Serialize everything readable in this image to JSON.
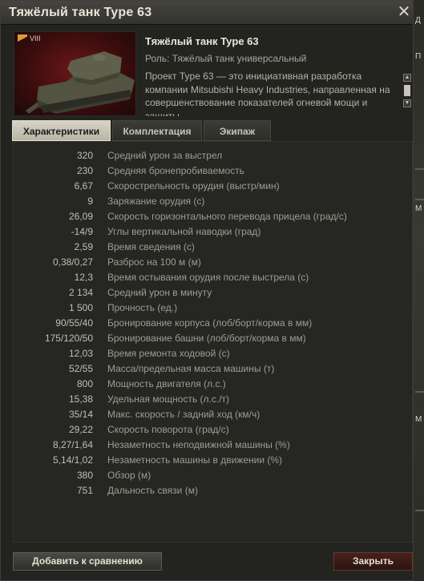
{
  "window": {
    "title": "Тяжёлый танк Type 63",
    "close_glyph": "✕"
  },
  "tank": {
    "tier": "VIII",
    "name": "Тяжёлый танк Type 63",
    "role": "Роль: Тяжёлый танк универсальный",
    "description": "Проект Type 63 — это инициативная разработка компании Mitsubishi Heavy Industries, направленная на совершенствование показателей огневой мощи и защиты"
  },
  "tabs": [
    {
      "label": "Характеристики",
      "active": true
    },
    {
      "label": "Комплектация",
      "active": false
    },
    {
      "label": "Экипаж",
      "active": false
    }
  ],
  "stats": [
    {
      "value": "320",
      "name": "Средний урон за выстрел"
    },
    {
      "value": "230",
      "name": "Средняя бронепробиваемость"
    },
    {
      "value": "6,67",
      "name": "Скорострельность орудия (выстр/мин)"
    },
    {
      "value": "9",
      "name": "Заряжание орудия (с)"
    },
    {
      "value": "26,09",
      "name": "Скорость горизонтального перевода прицела (град/с)"
    },
    {
      "value": "-14/9",
      "name": "Углы вертикальной наводки (град)"
    },
    {
      "value": "2,59",
      "name": "Время сведения (с)"
    },
    {
      "value": "0,38/0,27",
      "name": "Разброс на 100 м (м)"
    },
    {
      "value": "12,3",
      "name": "Время остывания орудия после выстрела (с)"
    },
    {
      "value": "2 134",
      "name": "Средний урон в минуту"
    },
    {
      "value": "1 500",
      "name": "Прочность (ед.)"
    },
    {
      "value": "90/55/40",
      "name": "Бронирование корпуса (лоб/борт/корма в мм)"
    },
    {
      "value": "175/120/50",
      "name": "Бронирование башни (лоб/борт/корма в мм)"
    },
    {
      "value": "12,03",
      "name": "Время ремонта ходовой (с)"
    },
    {
      "value": "52/55",
      "name": "Масса/предельная масса машины (т)"
    },
    {
      "value": "800",
      "name": "Мощность двигателя (л.с.)"
    },
    {
      "value": "15,38",
      "name": "Удельная мощность (л.с./т)"
    },
    {
      "value": "35/14",
      "name": "Макс. скорость / задний ход (км/ч)"
    },
    {
      "value": "29,22",
      "name": "Скорость поворота (град/с)"
    },
    {
      "value": "8,27/1,64",
      "name": "Незаметность неподвижной машины (%)"
    },
    {
      "value": "5,14/1,02",
      "name": "Незаметность машины в движении (%)"
    },
    {
      "value": "380",
      "name": "Обзор (м)"
    },
    {
      "value": "751",
      "name": "Дальность связи (м)"
    }
  ],
  "footer": {
    "compare_label": "Добавить к сравнению",
    "close_label": "Закрыть"
  },
  "background": {
    "fragments": [
      "Д",
      "П",
      "М",
      "М"
    ]
  },
  "colors": {
    "accent_red": "#6a1818",
    "tier_orange": "#d89a3a",
    "active_tab": "#d7d3c5"
  }
}
